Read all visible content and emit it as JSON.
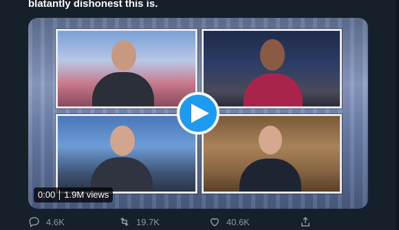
{
  "tweet": {
    "text_fragment": "blatantly dishonest this is."
  },
  "video": {
    "current_time": "0:00",
    "views": "1.9M views"
  },
  "actions": {
    "reply_count": "4.6K",
    "retweet_count": "19.7K",
    "like_count": "40.6K"
  },
  "icons": [
    "reply-icon",
    "retweet-icon",
    "like-icon",
    "share-icon",
    "play-icon"
  ],
  "colors": {
    "background": "#15202b",
    "accent": "#1d9bf0",
    "muted_text": "#8b98a5"
  }
}
